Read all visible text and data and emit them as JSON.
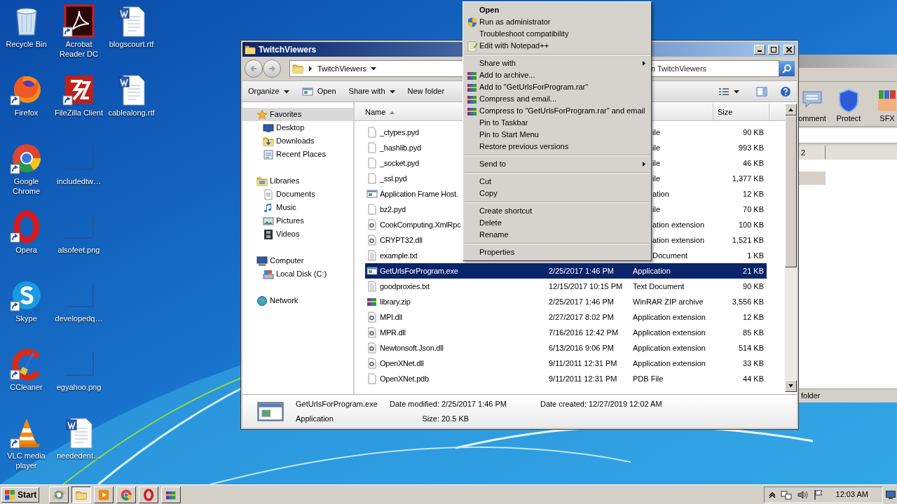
{
  "desktop": {
    "icons": [
      {
        "label": "Recycle Bin",
        "kind": "recycle",
        "shortcut": false
      },
      {
        "label": "Firefox",
        "kind": "firefox",
        "shortcut": true
      },
      {
        "label": "Google Chrome",
        "kind": "chrome",
        "shortcut": true
      },
      {
        "label": "Opera",
        "kind": "opera",
        "shortcut": true
      },
      {
        "label": "Skype",
        "kind": "skype",
        "shortcut": true
      },
      {
        "label": "CCleaner",
        "kind": "ccleaner",
        "shortcut": true
      },
      {
        "label": "VLC media player",
        "kind": "vlc",
        "shortcut": true
      },
      {
        "label": "Acrobat Reader DC",
        "kind": "acrobat",
        "shortcut": true
      },
      {
        "label": "FileZilla Client",
        "kind": "filezilla",
        "shortcut": true
      },
      {
        "label": "includedtw…",
        "kind": "image",
        "shortcut": false
      },
      {
        "label": "alsofeet.png",
        "kind": "image",
        "shortcut": false
      },
      {
        "label": "developedq…",
        "kind": "image",
        "shortcut": false
      },
      {
        "label": "egyahoo.png",
        "kind": "image",
        "shortcut": false
      },
      {
        "label": "neededent…",
        "kind": "word",
        "shortcut": false
      },
      {
        "label": "blogscourt.rtf",
        "kind": "word",
        "shortcut": false
      },
      {
        "label": "cablealong.rtf",
        "kind": "word",
        "shortcut": false
      }
    ]
  },
  "background_window": {
    "toolbar": [
      {
        "label": "omment",
        "kind": "comment"
      },
      {
        "label": "Protect",
        "kind": "protect"
      },
      {
        "label": "SFX",
        "kind": "sfx"
      }
    ],
    "column": "2",
    "rows": [
      {
        "selected": true
      }
    ],
    "status": "folder"
  },
  "explorer": {
    "title": "TwitchViewers",
    "address": "TwitchViewers",
    "search": {
      "placeholder": "n TwitchViewers"
    },
    "toolbar": [
      {
        "label": "Organize",
        "kind": "menu"
      },
      {
        "label": "Open",
        "kind": "icon"
      },
      {
        "label": "Share with",
        "kind": "menu"
      },
      {
        "label": "New folder",
        "kind": "plain"
      }
    ],
    "navigation": [
      {
        "label": "Favorites",
        "kind": "favorites",
        "selected": true,
        "children": [
          {
            "label": "Desktop",
            "kind": "desktop",
            "selected": false
          },
          {
            "label": "Downloads",
            "kind": "downloads",
            "selected": false
          },
          {
            "label": "Recent Places",
            "kind": "recent",
            "selected": false
          }
        ]
      },
      {
        "label": "Libraries",
        "kind": "libraries",
        "selected": false,
        "children": [
          {
            "label": "Documents",
            "kind": "documents",
            "selected": false
          },
          {
            "label": "Music",
            "kind": "music",
            "selected": false
          },
          {
            "label": "Pictures",
            "kind": "pictures",
            "selected": false
          },
          {
            "label": "Videos",
            "kind": "videos",
            "selected": false
          }
        ]
      },
      {
        "label": "Computer",
        "kind": "computer",
        "selected": false,
        "children": [
          {
            "label": "Local Disk (C:)",
            "kind": "disk",
            "selected": false
          }
        ]
      },
      {
        "label": "Network",
        "kind": "network",
        "selected": false
      }
    ],
    "columns": [
      {
        "label": "Name",
        "sorted": true
      },
      {
        "label": "Size",
        "sorted": false
      }
    ],
    "rows": [
      {
        "name": "_ctypes.pyd",
        "kind": "file",
        "type": "ile",
        "size": "90 KB",
        "selected": false
      },
      {
        "name": "_hashlib.pyd",
        "kind": "file",
        "type": "ile",
        "size": "993 KB",
        "selected": false
      },
      {
        "name": "_socket.pyd",
        "kind": "file",
        "type": "ile",
        "size": "46 KB",
        "selected": false
      },
      {
        "name": "_ssl.pyd",
        "kind": "file",
        "type": "ile",
        "size": "1,377 KB",
        "selected": false
      },
      {
        "name": "Application Frame Host.",
        "kind": "app",
        "type": "ation",
        "size": "12 KB",
        "selected": false
      },
      {
        "name": "bz2.pyd",
        "kind": "file",
        "type": "ile",
        "size": "70 KB",
        "selected": false
      },
      {
        "name": "CookComputing.XmlRpc",
        "kind": "dll",
        "type": "ation extension",
        "size": "100 KB",
        "selected": false
      },
      {
        "name": "CRYPT32.dll",
        "kind": "dll",
        "type": "ation extension",
        "size": "1,521 KB",
        "selected": false
      },
      {
        "name": "example.txt",
        "kind": "text",
        "type": "Document",
        "size": "1 KB",
        "selected": false
      },
      {
        "name": "GetUrlsForProgram.exe",
        "kind": "app",
        "date": "2/25/2017 1:46 PM",
        "type": "Application",
        "size": "21 KB",
        "selected": true
      },
      {
        "name": "goodproxies.txt",
        "kind": "text",
        "date": "12/15/2017 10:15 PM",
        "type": "Text Document",
        "size": "90 KB",
        "selected": false
      },
      {
        "name": "library.zip",
        "kind": "zip",
        "date": "2/25/2017 1:46 PM",
        "type": "WinRAR ZIP archive",
        "size": "3,556 KB",
        "selected": false
      },
      {
        "name": "MPI.dll",
        "kind": "dll",
        "date": "2/27/2017 8:02 PM",
        "type": "Application extension",
        "size": "12 KB",
        "selected": false
      },
      {
        "name": "MPR.dll",
        "kind": "dll",
        "date": "7/16/2016 12:42 PM",
        "type": "Application extension",
        "size": "85 KB",
        "selected": false
      },
      {
        "name": "Newtonsoft.Json.dll",
        "kind": "dll",
        "date": "6/13/2016 9:06 PM",
        "type": "Application extension",
        "size": "514 KB",
        "selected": false
      },
      {
        "name": "OpenXNet.dll",
        "kind": "dll",
        "date": "9/11/2011 12:31 PM",
        "type": "Application extension",
        "size": "33 KB",
        "selected": false
      },
      {
        "name": "OpenXNet.pdb",
        "kind": "file",
        "date": "9/11/2011 12:31 PM",
        "type": "PDB File",
        "size": "44 KB",
        "selected": false
      }
    ],
    "details": {
      "name": "GetUrlsForProgram.exe",
      "type": "Application",
      "fields": [
        {
          "label": "Date modified:",
          "value": "2/25/2017 1:46 PM"
        },
        {
          "label": "Size:",
          "value": "20.5 KB"
        },
        {
          "label": "Date created:",
          "value": "12/27/2019 12:02 AM"
        }
      ]
    }
  },
  "context_menu": {
    "groups": [
      {
        "items": [
          {
            "label": "Open",
            "kind": "plain",
            "default": true,
            "submenu": false
          },
          {
            "label": "Run as administrator",
            "kind": "admin",
            "default": false,
            "submenu": false
          },
          {
            "label": "Troubleshoot compatibility",
            "kind": "plain",
            "default": false,
            "submenu": false
          },
          {
            "label": "Edit with Notepad++",
            "kind": "editor",
            "default": false,
            "submenu": false
          }
        ]
      },
      {
        "items": [
          {
            "label": "Share with",
            "kind": "plain",
            "default": false,
            "submenu": true
          },
          {
            "label": "Add to archive...",
            "kind": "archive",
            "default": false,
            "submenu": false
          },
          {
            "label": "Add to \"GetUrlsForProgram.rar\"",
            "kind": "archive",
            "default": false,
            "submenu": false
          },
          {
            "label": "Compress and email...",
            "kind": "archive",
            "default": false,
            "submenu": false
          },
          {
            "label": "Compress to \"GetUrlsForProgram.rar\" and email",
            "kind": "archive",
            "default": false,
            "submenu": false
          },
          {
            "label": "Pin to Taskbar",
            "kind": "plain",
            "default": false,
            "submenu": false
          },
          {
            "label": "Pin to Start Menu",
            "kind": "plain",
            "default": false,
            "submenu": false
          },
          {
            "label": "Restore previous versions",
            "kind": "plain",
            "default": false,
            "submenu": false
          }
        ]
      },
      {
        "items": [
          {
            "label": "Send to",
            "kind": "plain",
            "default": false,
            "submenu": true
          }
        ]
      },
      {
        "items": [
          {
            "label": "Cut",
            "kind": "plain",
            "default": false,
            "submenu": false
          },
          {
            "label": "Copy",
            "kind": "plain",
            "default": false,
            "submenu": false
          }
        ]
      },
      {
        "items": [
          {
            "label": "Create shortcut",
            "kind": "plain",
            "default": false,
            "submenu": false
          },
          {
            "label": "Delete",
            "kind": "plain",
            "default": false,
            "submenu": false
          },
          {
            "label": "Rename",
            "kind": "plain",
            "default": false,
            "submenu": false
          }
        ]
      },
      {
        "items": [
          {
            "label": "Properties",
            "kind": "plain",
            "default": false,
            "submenu": false
          }
        ]
      }
    ]
  },
  "taskbar": {
    "start": "Start",
    "apps": [
      {
        "kind": "ie",
        "selected": false
      },
      {
        "kind": "explorer",
        "selected": true
      },
      {
        "kind": "media",
        "selected": false
      },
      {
        "kind": "chrome",
        "selected": false
      },
      {
        "kind": "opera",
        "selected": false
      },
      {
        "kind": "winrar",
        "selected": false
      }
    ],
    "clock": "12:03 AM"
  }
}
